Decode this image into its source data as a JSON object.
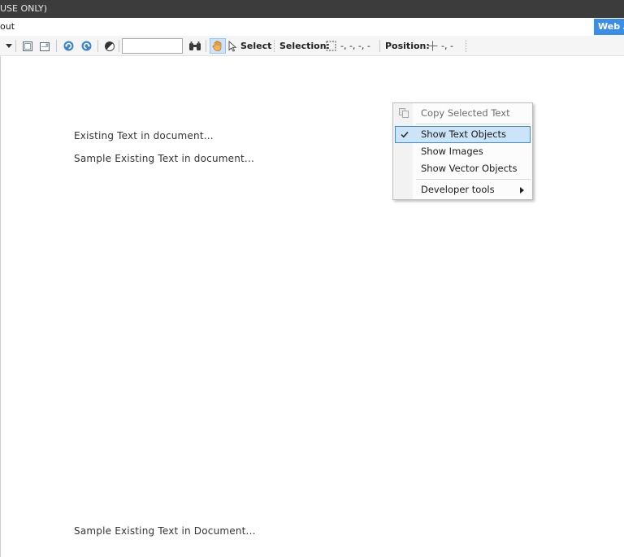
{
  "window": {
    "title_fragment": "USE ONLY)"
  },
  "menubar": {
    "about_fragment": "out",
    "web_button": "Web A"
  },
  "toolbar": {
    "zoom_value": "",
    "select_label": "Select",
    "selection_label": "Selection:",
    "selection_value": "-, -, -, -",
    "position_label": "Position:",
    "position_value": "-, -"
  },
  "document": {
    "lines": [
      "Existing Text in document...",
      "Sample Existing Text in document...",
      "Sample Existing Text in Document..."
    ]
  },
  "context_menu": {
    "items": [
      {
        "label": "Copy Selected Text",
        "icon": "copy-icon",
        "enabled": false
      },
      {
        "label": "Show Text Objects",
        "checked": true,
        "highlighted": true
      },
      {
        "label": "Show Images"
      },
      {
        "label": "Show Vector Objects"
      },
      {
        "label": "Developer tools",
        "submenu": true
      }
    ]
  },
  "colors": {
    "accent": "#3a8ee6",
    "highlight_bg": "#cce4f7",
    "highlight_border": "#3e8ddd",
    "titlebar": "#3c3c3c"
  }
}
